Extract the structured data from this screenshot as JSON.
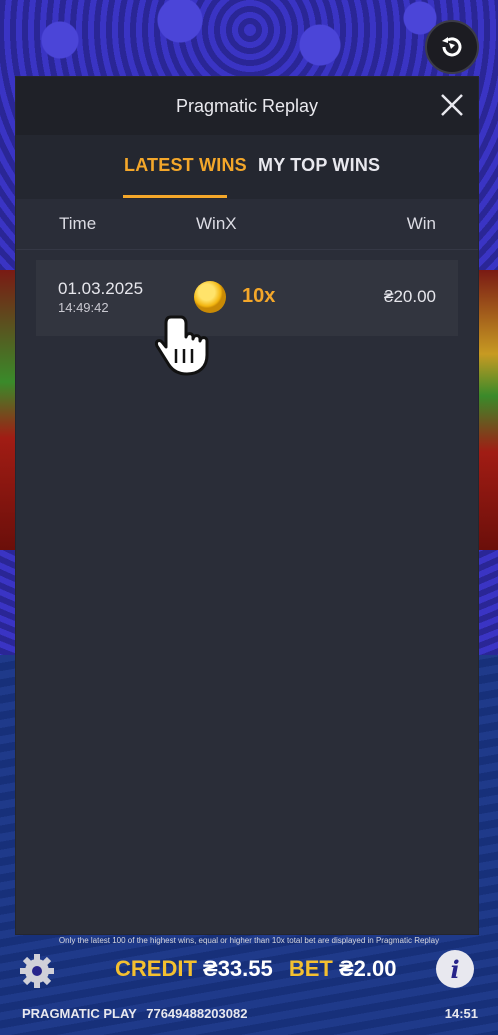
{
  "modal": {
    "title": "Pragmatic Replay",
    "tabs": [
      {
        "label": "LATEST WINS",
        "active": true
      },
      {
        "label": "MY TOP WINS",
        "active": false
      }
    ],
    "columns": [
      "Time",
      "WinX",
      "Win"
    ],
    "rows": [
      {
        "date": "01.03.2025",
        "time": "14:49:42",
        "winx": "10x",
        "win": "₴20.00"
      }
    ],
    "footnote": "Only the latest 100 of the highest wins, equal or higher than 10x total bet are displayed in Pragmatic Replay"
  },
  "bottom_bar": {
    "credit_label": "CREDIT",
    "credit_value": "₴33.55",
    "bet_label": "BET",
    "bet_value": "₴2.00",
    "brand": "PRAGMATIC PLAY",
    "session_id": "77649488203082",
    "clock": "14:51"
  },
  "icons": [
    "replay-icon",
    "close-icon",
    "coin-icon",
    "hand-cursor-icon",
    "gear-icon",
    "info-icon"
  ],
  "colors": {
    "accent": "#f4a72a",
    "panel": "#2a2d38",
    "header": "#1f2128"
  }
}
